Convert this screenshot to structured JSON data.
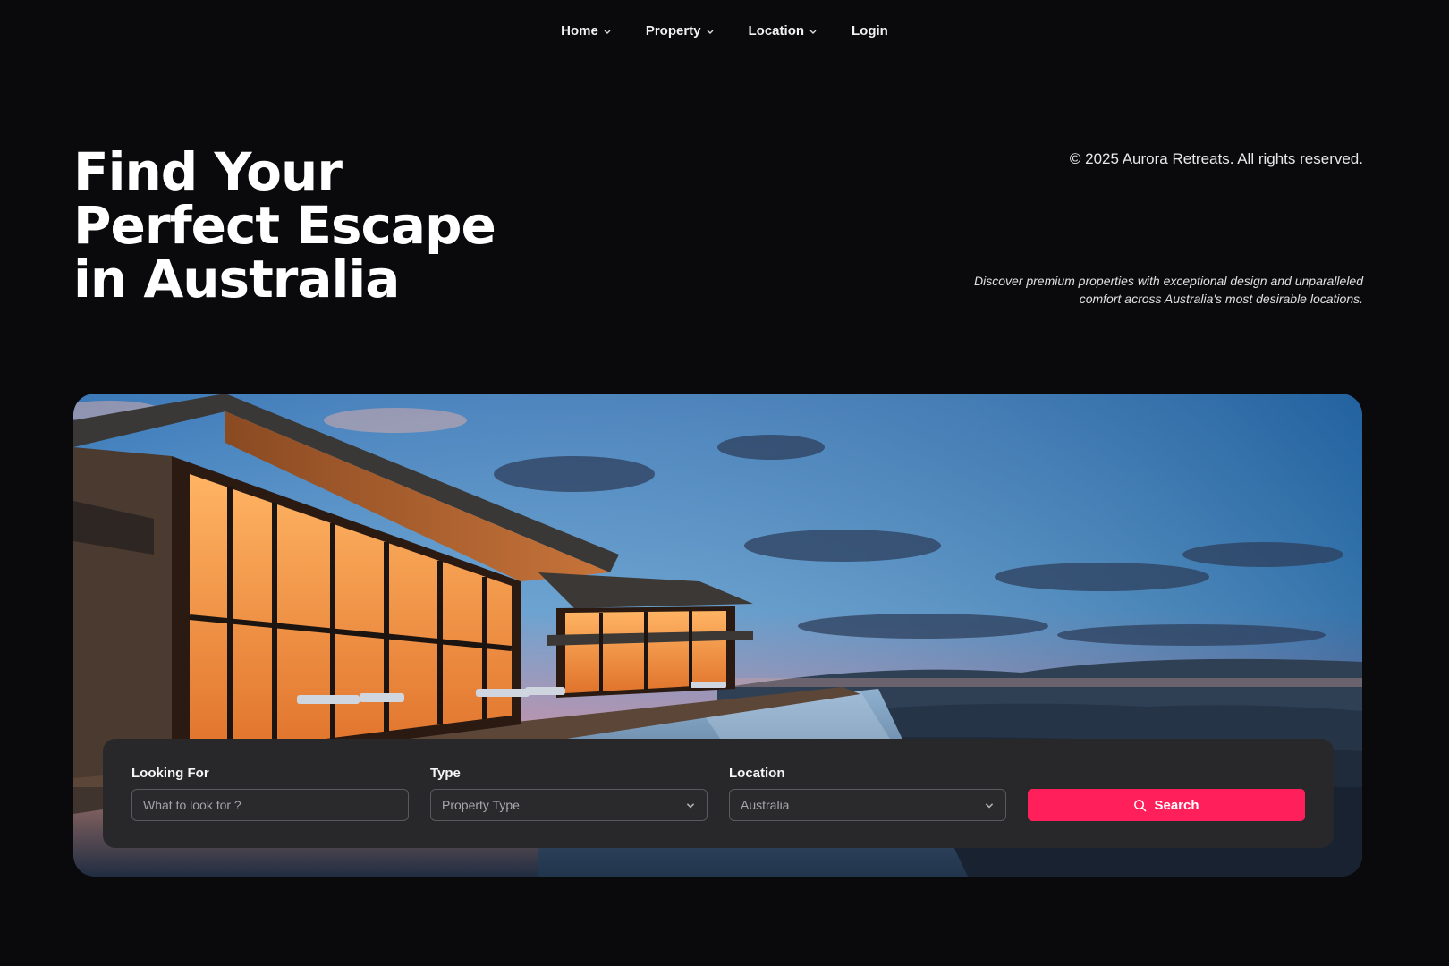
{
  "nav": {
    "items": [
      {
        "label": "Home",
        "has_dropdown": true
      },
      {
        "label": "Property",
        "has_dropdown": true
      },
      {
        "label": "Location",
        "has_dropdown": true
      },
      {
        "label": "Login",
        "has_dropdown": false
      }
    ]
  },
  "hero": {
    "title_lines": [
      "Find Your",
      "Perfect Escape",
      "in Australia"
    ],
    "copyright": "© 2025 Aurora Retreats. All rights reserved.",
    "tagline_lines": [
      "Discover premium properties with exceptional design and unparalleled",
      "comfort across Australia's most desirable locations."
    ]
  },
  "search": {
    "looking_for": {
      "label": "Looking For",
      "placeholder": "What to look for ?",
      "value": ""
    },
    "type": {
      "label": "Type",
      "value": "Property Type"
    },
    "location": {
      "label": "Location",
      "value": "Australia"
    },
    "button_label": "Search"
  },
  "colors": {
    "background": "#0a0a0d",
    "accent": "#ff1f5a",
    "panel": "#28282b"
  },
  "icons": {
    "dropdown": "chevron-down-icon",
    "search": "search-icon"
  }
}
